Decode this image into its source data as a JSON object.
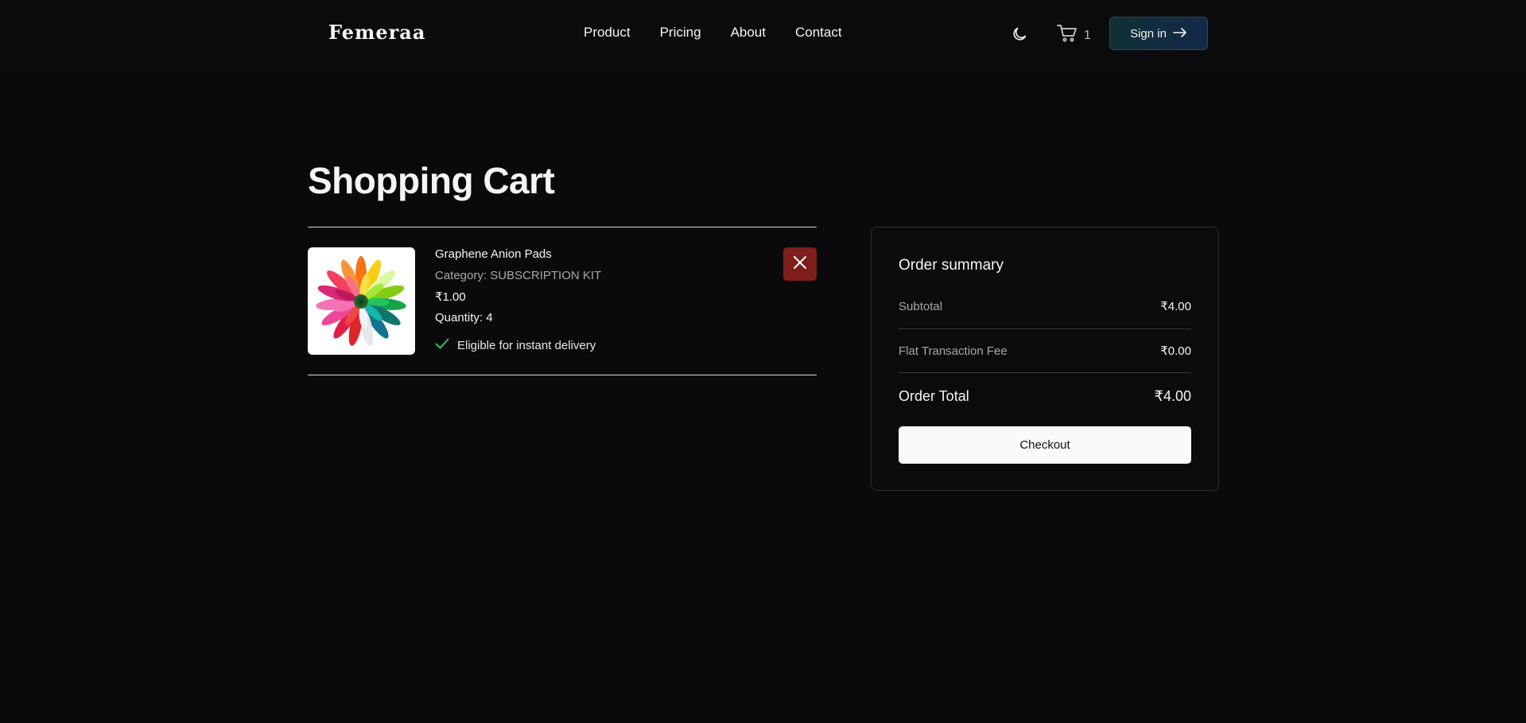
{
  "header": {
    "logo": "Femeraa",
    "nav": [
      "Product",
      "Pricing",
      "About",
      "Contact"
    ],
    "cart_count": "1",
    "signin_label": "Sign in"
  },
  "page": {
    "title": "Shopping Cart"
  },
  "cart": {
    "items": [
      {
        "name": "Graphene Anion Pads",
        "category": "Category: SUBSCRIPTION KIT",
        "price": "₹1.00",
        "quantity": "Quantity: 4",
        "delivery": "Eligible for instant delivery"
      }
    ]
  },
  "summary": {
    "title": "Order summary",
    "subtotal_label": "Subtotal",
    "subtotal_value": "₹4.00",
    "fee_label": "Flat Transaction Fee",
    "fee_value": "₹0.00",
    "total_label": "Order Total",
    "total_value": "₹4.00",
    "checkout_label": "Checkout"
  },
  "colors": {
    "background": "#0a0a0c",
    "remove_button": "#7f1d1d",
    "check_icon": "#22c55e",
    "checkout_button": "#fafafa"
  }
}
